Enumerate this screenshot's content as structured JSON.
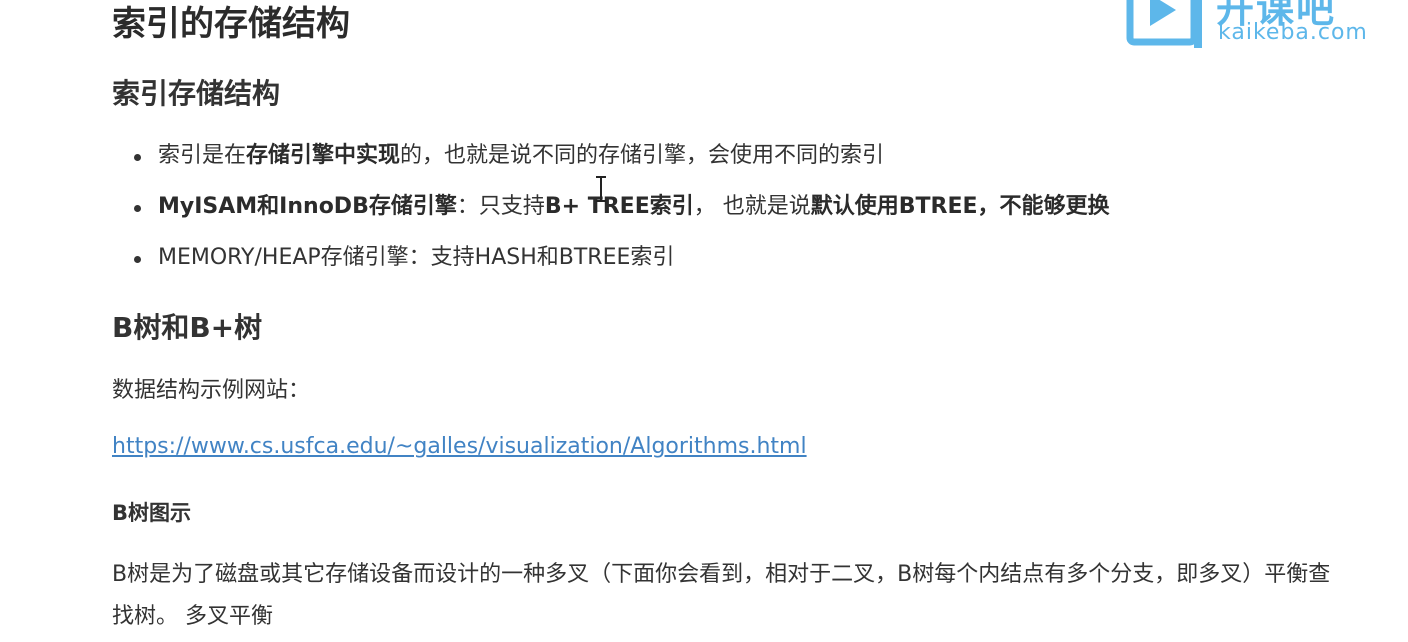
{
  "title": "索引的存储结构",
  "section1": {
    "heading": "索引存储结构",
    "items": [
      {
        "p1": "索引是在",
        "b1": "存储引擎中实现",
        "p2": "的，也就是说不同的存储引擎，会使用不同的索引"
      },
      {
        "b1": "MyISAM和InnoDB存储引擎",
        "p1": "：只支持",
        "b2": "B+ TREE索引",
        "p2": "， 也就是说",
        "b3": "默认使用BTREE，不能够更换"
      },
      {
        "p1": "MEMORY/HEAP存储引擎：支持HASH和BTREE索引"
      }
    ]
  },
  "section2": {
    "heading": "B树和B+树",
    "intro": "数据结构示例网站：",
    "link": "https://www.cs.usfca.edu/~galles/visualization/Algorithms.html",
    "subheading": "B树图示",
    "paragraph": "B树是为了磁盘或其它存储设备而设计的一种多叉（下面你会看到，相对于二叉，B树每个内结点有多个分支，即多叉）平衡查找树。 多叉平衡"
  },
  "logo": {
    "cn": "开课吧",
    "en": "kaikeba.com",
    "color": "#5db7ea"
  },
  "colors": {
    "text": "#333333",
    "link": "#4183c4"
  }
}
